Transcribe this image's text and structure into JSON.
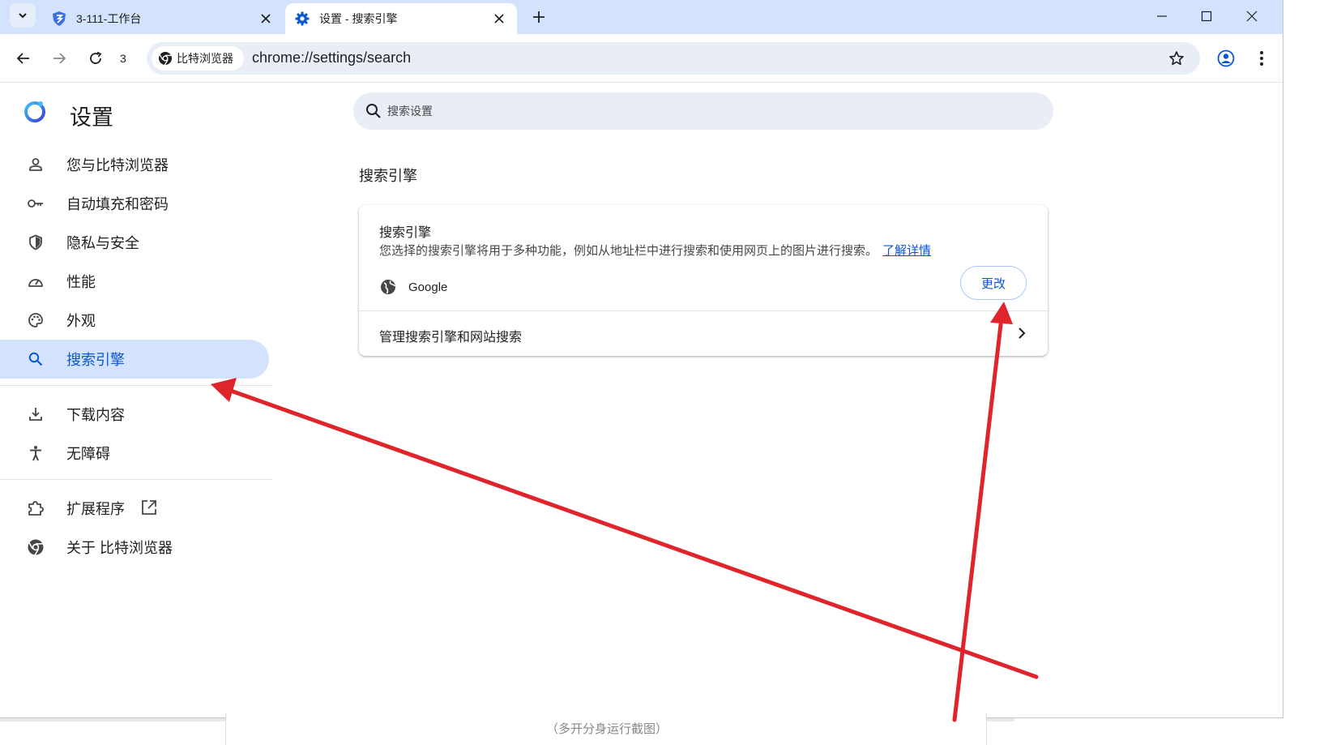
{
  "tabs": {
    "list_button_icon": "chevron-down-icon",
    "inactive": {
      "title": "3-111-工作台",
      "icon": "bitbrowser-shield-icon"
    },
    "active": {
      "title": "设置 - 搜索引擎",
      "icon": "gear-icon"
    },
    "new_tab_icon": "plus-icon"
  },
  "window_controls": [
    "minimize-icon",
    "maximize-icon",
    "close-icon"
  ],
  "toolbar": {
    "reload_count": "3",
    "site_chip_label": "比特浏览器",
    "url": "chrome://settings/search"
  },
  "settings": {
    "title": "设置",
    "search_placeholder": "搜索设置",
    "nav": [
      {
        "label": "您与比特浏览器",
        "icon": "person-icon"
      },
      {
        "label": "自动填充和密码",
        "icon": "key-icon"
      },
      {
        "label": "隐私与安全",
        "icon": "shield-icon"
      },
      {
        "label": "性能",
        "icon": "speedometer-icon"
      },
      {
        "label": "外观",
        "icon": "palette-icon"
      },
      {
        "label": "搜索引擎",
        "icon": "search-icon",
        "selected": true
      },
      {
        "label": "下载内容",
        "icon": "download-icon"
      },
      {
        "label": "无障碍",
        "icon": "accessibility-icon"
      },
      {
        "label": "扩展程序",
        "icon": "puzzle-icon",
        "external_icon": "open-external-icon"
      },
      {
        "label": "关于 比特浏览器",
        "icon": "chrome-logo-icon"
      }
    ],
    "section_title": "搜索引擎",
    "card": {
      "heading": "搜索引擎",
      "description": "您选择的搜索引擎将用于多种功能，例如从地址栏中进行搜索和使用网页上的图片进行搜索。",
      "learn_more": "了解详情",
      "engine_name": "Google",
      "change_label": "更改",
      "manage_label": "管理搜索引擎和网站搜索"
    }
  },
  "background_caption": "（多开分身运行截图）",
  "colors": {
    "accent": "#0b57d0",
    "selected_bg": "#d3e3fd",
    "annotation_arrow": "#e0242b"
  }
}
